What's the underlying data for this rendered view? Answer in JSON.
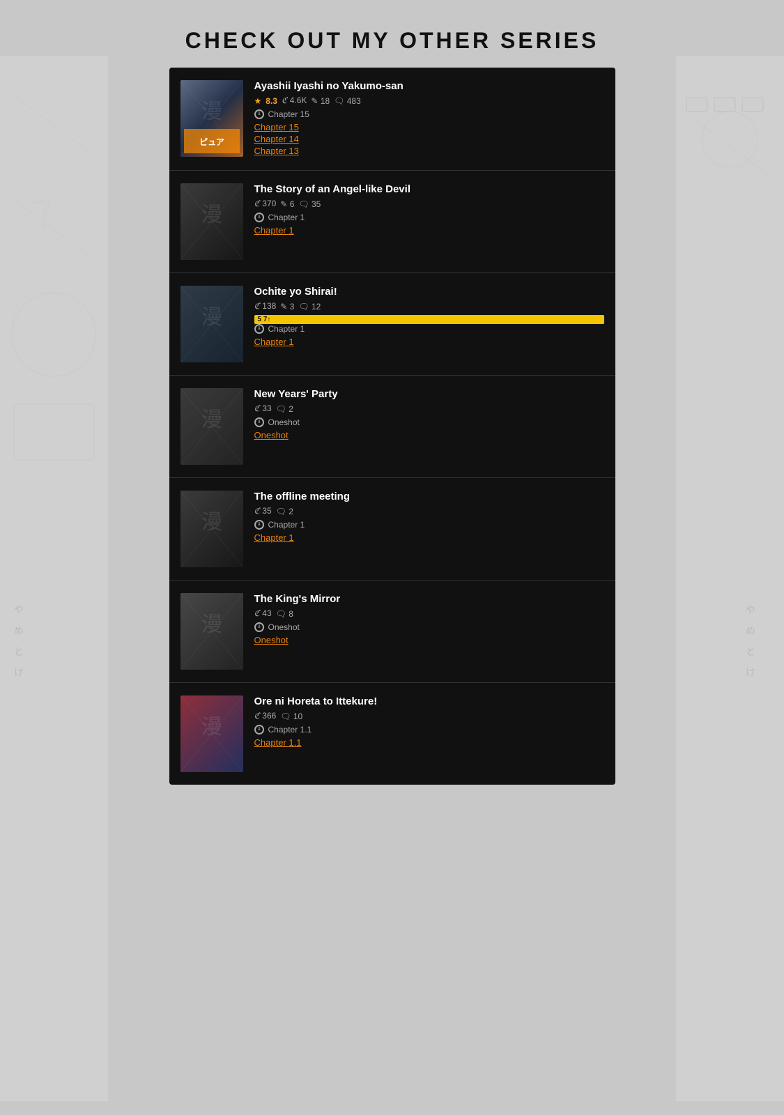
{
  "page": {
    "title": "CHECK OUT MY OTHER SERIES"
  },
  "series": [
    {
      "id": 1,
      "title": "Ayashii Iyashi no Yakumo-san",
      "rating": "8.3",
      "views": "4.6K",
      "bookmarks": "18",
      "comments": "483",
      "has_rating": true,
      "badge": null,
      "latest": "Chapter 15",
      "chapters": [
        "Chapter 15",
        "Chapter 14",
        "Chapter 13"
      ],
      "thumb_class": "thumb-1"
    },
    {
      "id": 2,
      "title": "The Story of an Angel-like Devil",
      "rating": null,
      "views": "370",
      "bookmarks": "6",
      "comments": "35",
      "has_rating": false,
      "badge": null,
      "latest": "Chapter 1",
      "chapters": [
        "Chapter 1"
      ],
      "thumb_class": "thumb-2"
    },
    {
      "id": 3,
      "title": "Ochite yo Shirai!",
      "rating": null,
      "views": "138",
      "bookmarks": "3",
      "comments": "12",
      "has_rating": false,
      "badge": "5 7↑",
      "latest": "Chapter 1",
      "chapters": [
        "Chapter 1"
      ],
      "thumb_class": "thumb-3"
    },
    {
      "id": 4,
      "title": "New Years' Party",
      "rating": null,
      "views": "33",
      "bookmarks": null,
      "comments": "2",
      "has_rating": false,
      "badge": null,
      "latest": "Oneshot",
      "chapters": [
        "Oneshot"
      ],
      "thumb_class": "thumb-4"
    },
    {
      "id": 5,
      "title": "The offline meeting",
      "rating": null,
      "views": "35",
      "bookmarks": null,
      "comments": "2",
      "has_rating": false,
      "badge": null,
      "latest": "Chapter 1",
      "chapters": [
        "Chapter 1"
      ],
      "thumb_class": "thumb-5"
    },
    {
      "id": 6,
      "title": "The King's Mirror",
      "rating": null,
      "views": "43",
      "bookmarks": null,
      "comments": "8",
      "has_rating": false,
      "badge": null,
      "latest": "Oneshot",
      "chapters": [
        "Oneshot"
      ],
      "thumb_class": "thumb-6"
    },
    {
      "id": 7,
      "title": "Ore ni Horeta to Ittekure!",
      "rating": null,
      "views": "366",
      "bookmarks": null,
      "comments": "10",
      "has_rating": false,
      "badge": null,
      "latest": "Chapter 1.1",
      "chapters": [
        "Chapter 1.1"
      ],
      "thumb_class": "thumb-7"
    }
  ],
  "icons": {
    "star": "★",
    "views": "👁",
    "bookmark": "🔖",
    "comment": "💬",
    "clock": "🕐",
    "views_symbol": "ℭ",
    "edit_symbol": "✎",
    "comment_symbol": "💬"
  }
}
